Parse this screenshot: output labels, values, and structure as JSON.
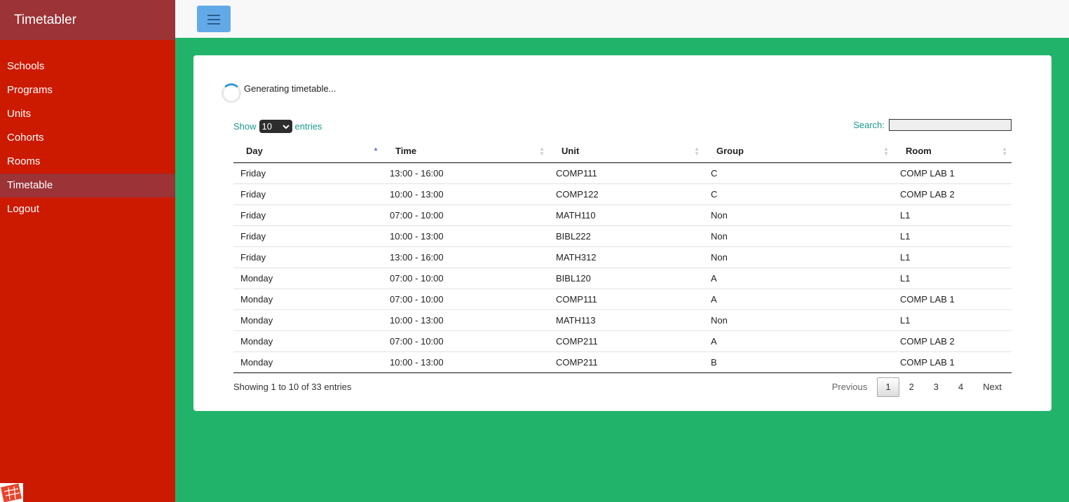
{
  "app": {
    "title": "Timetabler"
  },
  "sidebar": {
    "items": [
      {
        "label": "Schools",
        "active": false
      },
      {
        "label": "Programs",
        "active": false
      },
      {
        "label": "Units",
        "active": false
      },
      {
        "label": "Cohorts",
        "active": false
      },
      {
        "label": "Rooms",
        "active": false
      },
      {
        "label": "Timetable",
        "active": true
      },
      {
        "label": "Logout",
        "active": false
      }
    ]
  },
  "topbar": {
    "menu_icon": "hamburger-icon"
  },
  "status": {
    "loading_text": "Generating timetable..."
  },
  "table_controls": {
    "show_label": "Show",
    "length_value": "10",
    "entries_label": "entries",
    "search_label": "Search:",
    "search_value": ""
  },
  "table": {
    "columns": [
      "Day",
      "Time",
      "Unit",
      "Group",
      "Room"
    ],
    "sorted_column": "Day",
    "rows": [
      [
        "Friday",
        "13:00 - 16:00",
        "COMP111",
        "C",
        "COMP LAB 1"
      ],
      [
        "Friday",
        "10:00 - 13:00",
        "COMP122",
        "C",
        "COMP LAB 2"
      ],
      [
        "Friday",
        "07:00 - 10:00",
        "MATH110",
        "Non",
        "L1"
      ],
      [
        "Friday",
        "10:00 - 13:00",
        "BIBL222",
        "Non",
        "L1"
      ],
      [
        "Friday",
        "13:00 - 16:00",
        "MATH312",
        "Non",
        "L1"
      ],
      [
        "Monday",
        "07:00 - 10:00",
        "BIBL120",
        "A",
        "L1"
      ],
      [
        "Monday",
        "07:00 - 10:00",
        "COMP111",
        "A",
        "COMP LAB 1"
      ],
      [
        "Monday",
        "10:00 - 13:00",
        "MATH113",
        "Non",
        "L1"
      ],
      [
        "Monday",
        "07:00 - 10:00",
        "COMP211",
        "A",
        "COMP LAB 2"
      ],
      [
        "Monday",
        "10:00 - 13:00",
        "COMP211",
        "B",
        "COMP LAB 1"
      ]
    ]
  },
  "footer": {
    "info": "Showing 1 to 10 of 33 entries",
    "previous": "Previous",
    "pages": [
      "1",
      "2",
      "3",
      "4"
    ],
    "current_page": "1",
    "next": "Next"
  },
  "colors": {
    "sidebar": "#cc1a00",
    "sidebar_active": "#9b3337",
    "content_bg": "#22b36a",
    "accent_text": "#1a9a8c",
    "menu_button": "#62a9e8"
  }
}
